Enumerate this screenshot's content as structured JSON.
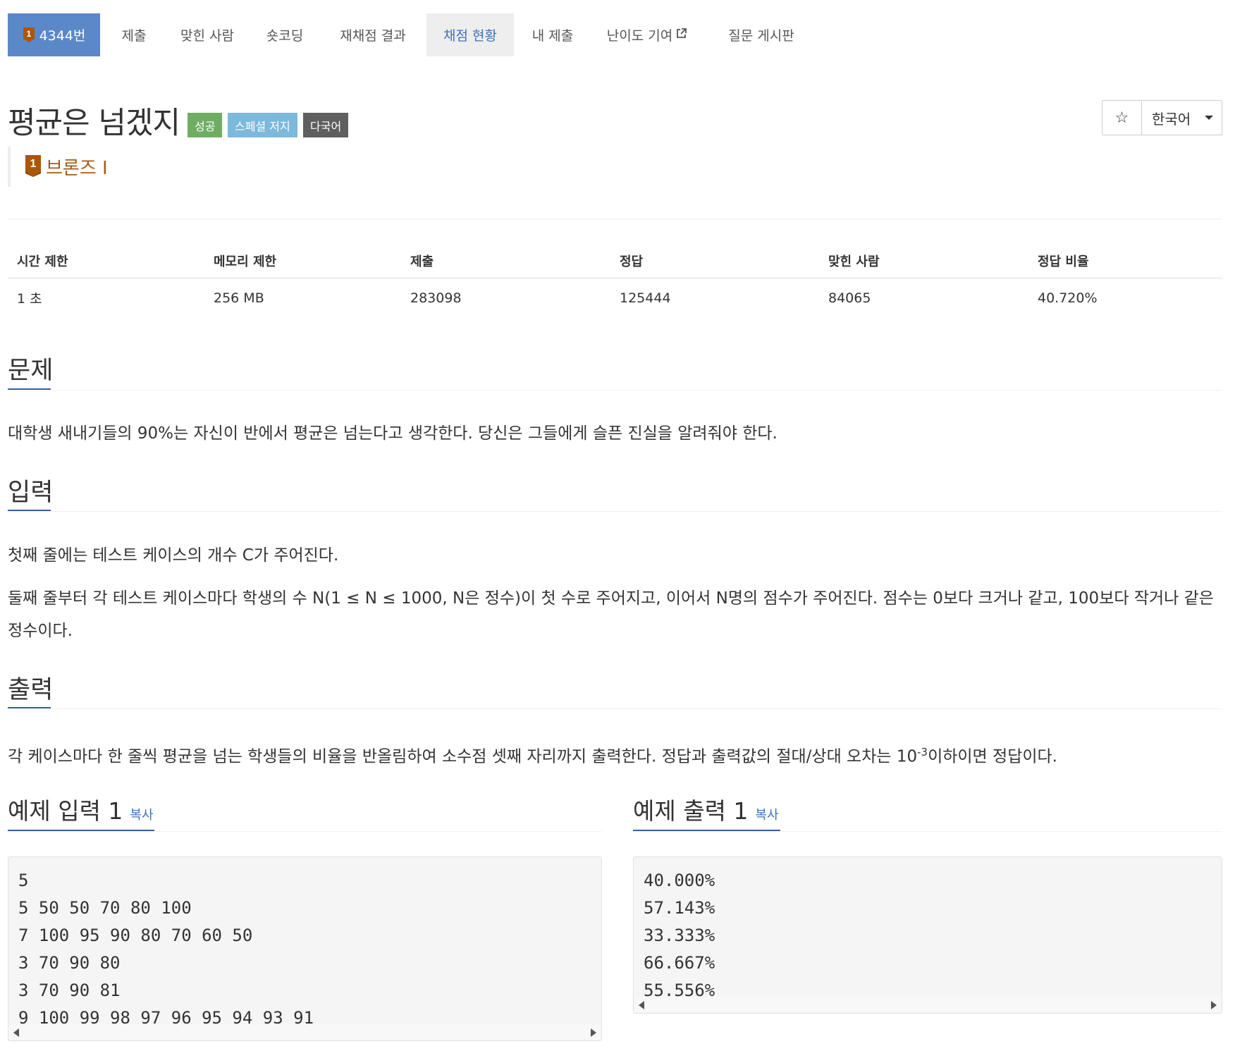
{
  "nav": {
    "problem_tab": "4344번",
    "tier_number": "1",
    "tabs": [
      "제출",
      "맞힌 사람",
      "숏코딩",
      "재채점 결과",
      "채점 현황",
      "내 제출",
      "난이도 기여",
      "질문 게시판"
    ],
    "active_tab": "채점 현황"
  },
  "problem": {
    "title": "평균은 넘겠지",
    "labels": {
      "success": "성공",
      "special": "스페셜 저지",
      "multi": "다국어"
    },
    "tier": "브론즈 I",
    "tier_number": "1",
    "tier_color": "#a35b1a"
  },
  "toolbar": {
    "star": "☆",
    "language": "한국어"
  },
  "info": {
    "headers": [
      "시간 제한",
      "메모리 제한",
      "제출",
      "정답",
      "맞힌 사람",
      "정답 비율"
    ],
    "values": [
      "1 초",
      "256 MB",
      "283098",
      "125444",
      "84065",
      "40.720%"
    ]
  },
  "sections": {
    "problem": {
      "heading": "문제",
      "text": "대학생 새내기들의 90%는 자신이 반에서 평균은 넘는다고 생각한다. 당신은 그들에게 슬픈 진실을 알려줘야 한다."
    },
    "input": {
      "heading": "입력",
      "text1": "첫째 줄에는 테스트 케이스의 개수 C가 주어진다.",
      "text2": "둘째 줄부터 각 테스트 케이스마다 학생의 수 N(1 ≤ N ≤ 1000, N은 정수)이 첫 수로 주어지고, 이어서 N명의 점수가 주어진다. 점수는 0보다 크거나 같고, 100보다 작거나 같은 정수이다."
    },
    "output": {
      "heading": "출력",
      "text_before": "각 케이스마다 한 줄씩 평균을 넘는 학생들의 비율을 반올림하여 소수점 셋째 자리까지 출력한다. 정답과 출력값의 절대/상대 오차는 10",
      "text_sup": "-3",
      "text_after": "이하이면 정답이다."
    }
  },
  "samples": {
    "input": {
      "heading": "예제 입력 1",
      "copy": "복사",
      "lines": [
        "5",
        "5 50 50 70 80 100",
        "7 100 95 90 80 70 60 50",
        "3 70 90 80",
        "3 70 90 81",
        "9 100 99 98 97 96 95 94 93 91"
      ]
    },
    "output": {
      "heading": "예제 출력 1",
      "copy": "복사",
      "lines": [
        "40.000%",
        "57.143%",
        "33.333%",
        "66.667%",
        "55.556%"
      ]
    }
  },
  "colors": {
    "accent": "#3c5ea8",
    "nav_problem_bg": "#5b88c8",
    "success": "#6fad63",
    "special": "#7db8dd",
    "multi": "#5f5f5f",
    "bronze": "#a35b1a"
  }
}
